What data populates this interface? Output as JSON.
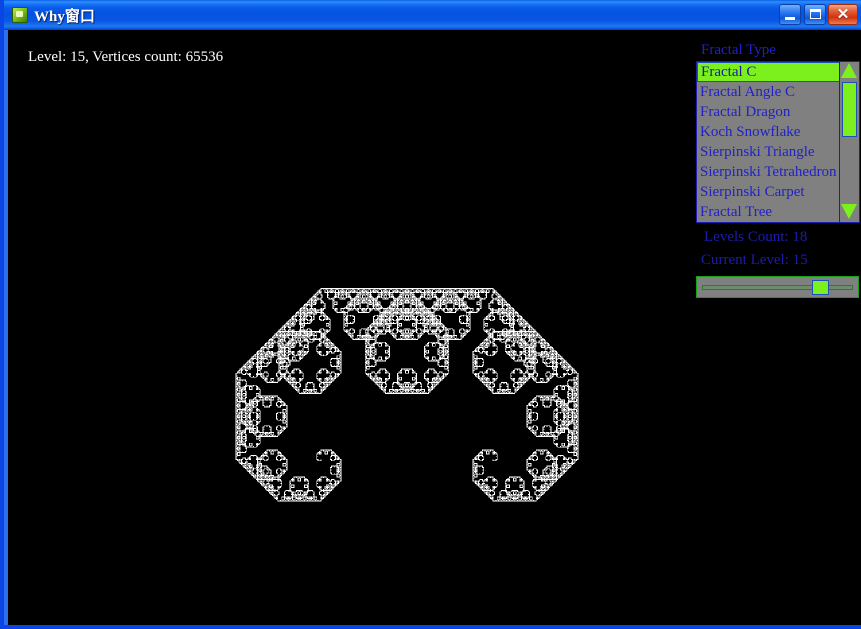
{
  "window": {
    "title": "Why窗口",
    "icon": "app-icon",
    "controls": {
      "minimize": "–",
      "maximize": "□",
      "close": "✕"
    }
  },
  "canvas": {
    "status_text": "Level: 15, Vertices count: 65536",
    "background_color": "#000000",
    "stroke_color": "#ffffff",
    "fractal": {
      "name": "Fractal C",
      "type": "levy-c-curve",
      "level": 15,
      "vertices_count": 65536
    }
  },
  "panel": {
    "fractal_type_label": "Fractal Type",
    "list": {
      "selected_index": 0,
      "items": [
        {
          "label": "Fractal C"
        },
        {
          "label": "Fractal Angle C"
        },
        {
          "label": "Fractal Dragon"
        },
        {
          "label": "Koch Snowflake"
        },
        {
          "label": "Sierpinski Triangle"
        },
        {
          "label": "Sierpinski Tetrahedron"
        },
        {
          "label": "Sierpinski Carpet"
        },
        {
          "label": "Fractal Tree"
        }
      ],
      "scrollbar": {
        "up_arrow": "scroll-up-arrow",
        "down_arrow": "scroll-down-arrow"
      }
    },
    "levels_count_label": "Levels Count: 18",
    "current_level_label": "Current Level: 15",
    "trackbar": {
      "min": 1,
      "max": 18,
      "value": 15
    }
  },
  "colors": {
    "titlebar_blue": "#0a5ae8",
    "frame_blue": "#0a46e6",
    "list_background": "#808080",
    "list_text": "#2121c6",
    "highlight_green": "#7cf01c",
    "label_blue": "#1c1caf",
    "canvas_black": "#000000",
    "fractal_white": "#ffffff"
  }
}
